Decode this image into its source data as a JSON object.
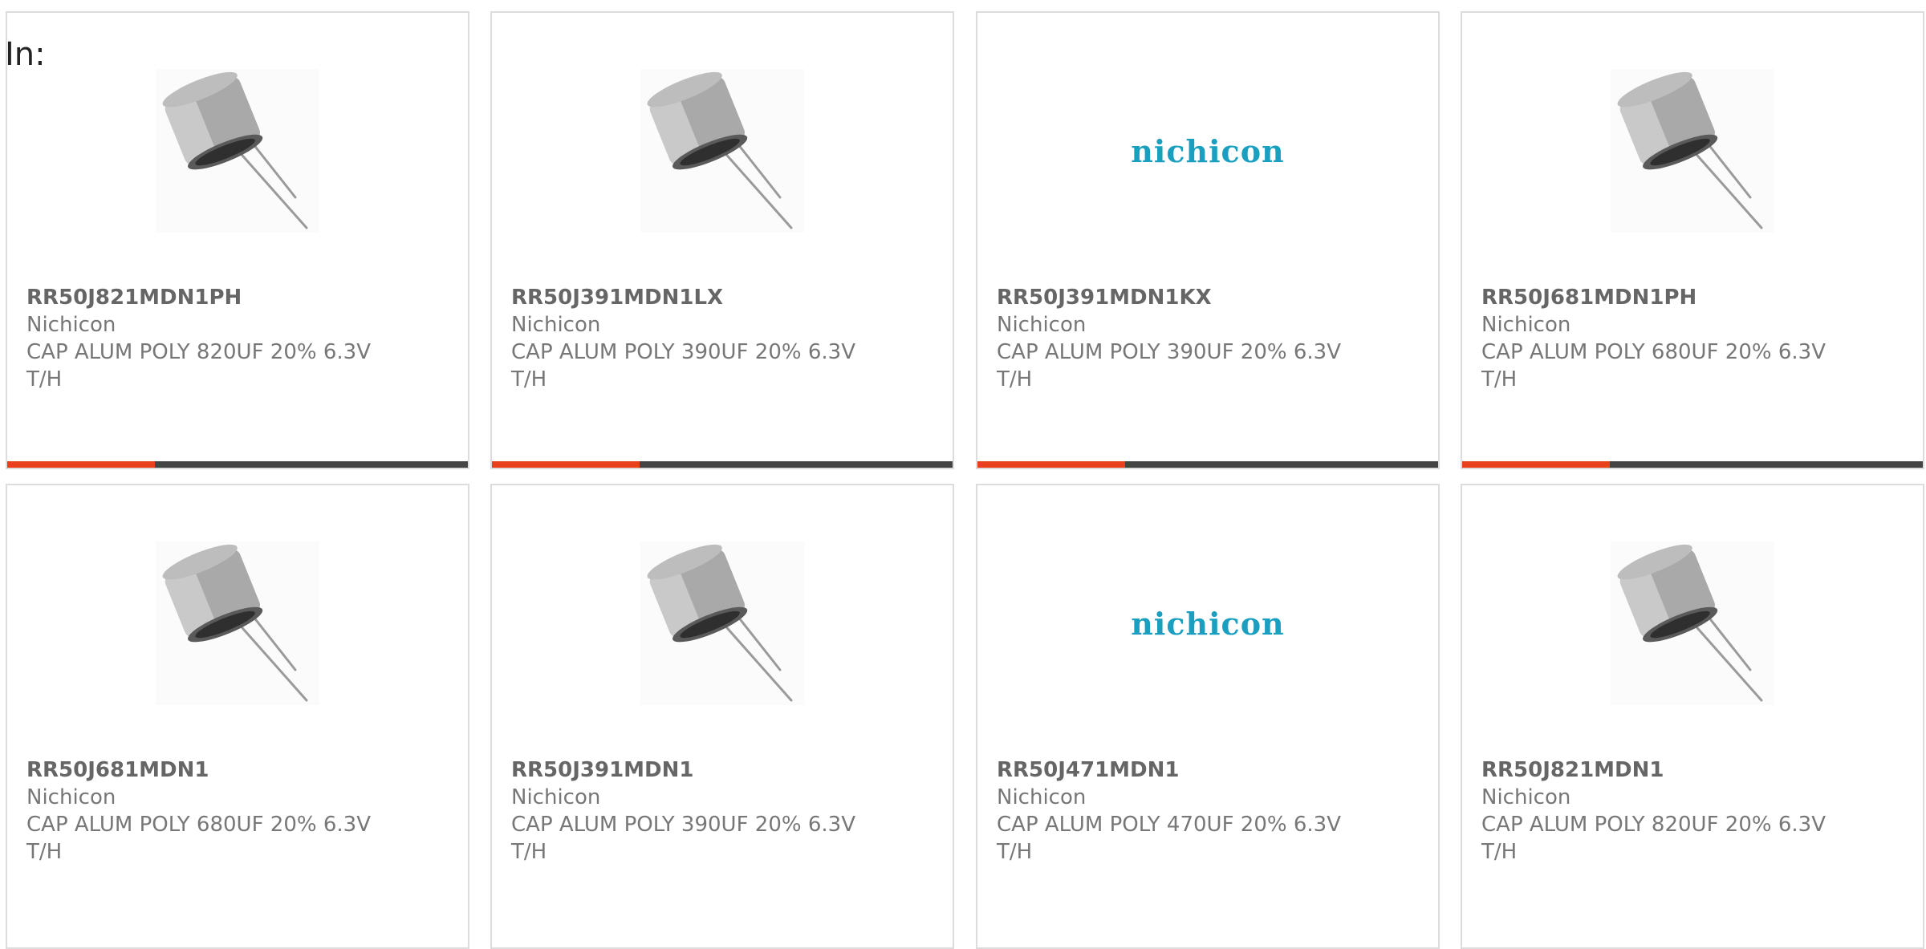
{
  "page": {
    "in_label": "In:"
  },
  "colors": {
    "accent_orange": "#e8401c",
    "accent_dark": "#444444",
    "logo_blue": "#1a9fc0",
    "card_border": "#dcdcdc",
    "text_gray": "#777777"
  },
  "products": [
    {
      "part_number": "RR50J821MDN1PH",
      "manufacturer": "Nichicon",
      "description": "CAP ALUM POLY 820UF 20% 6.3V T/H",
      "image": "capacitor-photo"
    },
    {
      "part_number": "RR50J391MDN1LX",
      "manufacturer": "Nichicon",
      "description": "CAP ALUM POLY 390UF 20% 6.3V T/H",
      "image": "capacitor-photo"
    },
    {
      "part_number": "RR50J391MDN1KX",
      "manufacturer": "Nichicon",
      "description": "CAP ALUM POLY 390UF 20% 6.3V T/H",
      "image": "nichicon-logo",
      "logo_text": "nichicon"
    },
    {
      "part_number": "RR50J681MDN1PH",
      "manufacturer": "Nichicon",
      "description": "CAP ALUM POLY 680UF 20% 6.3V T/H",
      "image": "capacitor-photo"
    },
    {
      "part_number": "RR50J681MDN1",
      "manufacturer": "Nichicon",
      "description": "CAP ALUM POLY 680UF 20% 6.3V T/H",
      "image": "capacitor-photo"
    },
    {
      "part_number": "RR50J391MDN1",
      "manufacturer": "Nichicon",
      "description": "CAP ALUM POLY 390UF 20% 6.3V T/H",
      "image": "capacitor-photo"
    },
    {
      "part_number": "RR50J471MDN1",
      "manufacturer": "Nichicon",
      "description": "CAP ALUM POLY 470UF 20% 6.3V T/H",
      "image": "nichicon-logo",
      "logo_text": "nichicon"
    },
    {
      "part_number": "RR50J821MDN1",
      "manufacturer": "Nichicon",
      "description": "CAP ALUM POLY 820UF 20% 6.3V T/H",
      "image": "capacitor-photo"
    }
  ]
}
